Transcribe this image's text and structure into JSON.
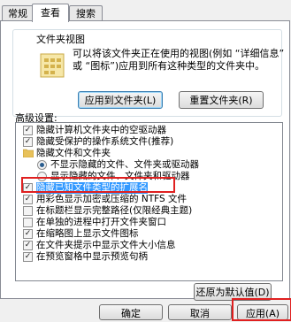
{
  "tabs": [
    {
      "label": "常规",
      "active": false
    },
    {
      "label": "查看",
      "active": true
    },
    {
      "label": "搜索",
      "active": false
    }
  ],
  "folder_view": {
    "title": "文件夹视图",
    "description": "可以将该文件夹正在使用的视图(例如 “详细信息” 或 “图标”)应用到所有这种类型的文件夹中。",
    "apply_button": "应用到文件夹(L)",
    "reset_button": "重置文件夹(R)"
  },
  "advanced": {
    "label": "高级设置:",
    "items": [
      {
        "type": "checkbox",
        "checked": true,
        "label": "隐藏计算机文件夹中的空驱动器"
      },
      {
        "type": "checkbox",
        "checked": true,
        "label": "隐藏受保护的操作系统文件(推荐)"
      },
      {
        "type": "folder",
        "label": "隐藏文件和文件夹"
      },
      {
        "type": "radio",
        "selected": true,
        "label": "不显示隐藏的文件、文件夹或驱动器"
      },
      {
        "type": "radio",
        "selected": false,
        "label": "显示隐藏的文件、文件夹和驱动器"
      },
      {
        "type": "checkbox",
        "checked": true,
        "label": "隐藏已知文件类型的扩展名",
        "highlighted": true
      },
      {
        "type": "checkbox",
        "checked": true,
        "label": "用彩色显示加密或压缩的 NTFS 文件"
      },
      {
        "type": "checkbox",
        "checked": false,
        "label": "在标题栏显示完整路径(仅限经典主题)"
      },
      {
        "type": "checkbox",
        "checked": false,
        "label": "在单独的进程中打开文件夹窗口"
      },
      {
        "type": "checkbox",
        "checked": true,
        "label": "在缩略图上显示文件图标"
      },
      {
        "type": "checkbox",
        "checked": true,
        "label": "在文件夹提示中显示文件大小信息"
      },
      {
        "type": "checkbox",
        "checked": true,
        "label": "在预览窗格中显示预览句柄"
      }
    ],
    "restore_button": "还原为默认值(D)"
  },
  "footer": {
    "ok": "确定",
    "cancel": "取消",
    "apply": "应用(A)"
  },
  "colors": {
    "highlight": "#3399ff",
    "annotation": "#e02020"
  }
}
